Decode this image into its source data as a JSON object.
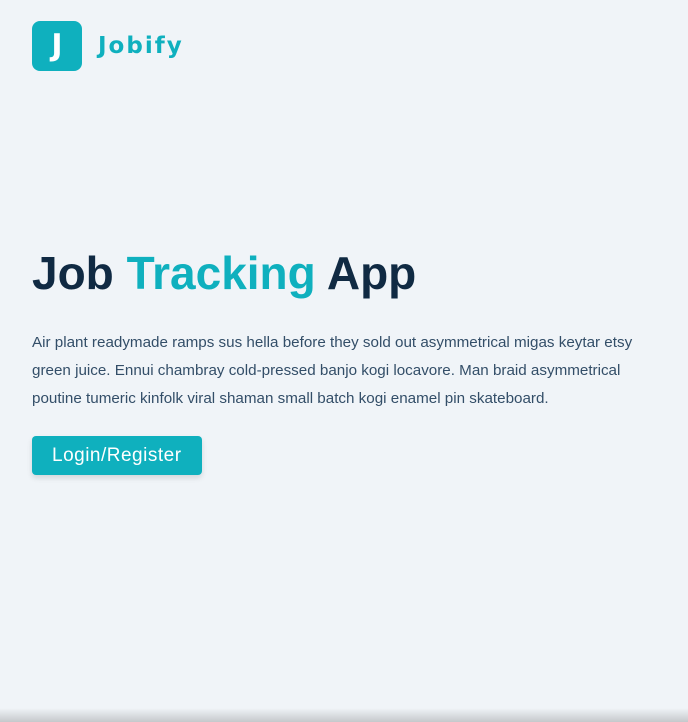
{
  "brand": {
    "logo_letter": "J",
    "name": "Jobify"
  },
  "hero": {
    "title_part1": "Job",
    "title_accent": "Tracking",
    "title_part2": "App",
    "description": "Air plant readymade ramps sus hella before they sold out asymmetrical migas keytar etsy green juice. Ennui chambray cold-pressed banjo kogi locavore. Man braid asymmetrical poutine tumeric kinfolk viral shaman small batch kogi enamel pin skateboard.",
    "cta_label": "Login/Register"
  },
  "colors": {
    "accent": "#0fb0be",
    "heading": "#102a43",
    "body_text": "#334e68",
    "background": "#f0f4f8"
  }
}
